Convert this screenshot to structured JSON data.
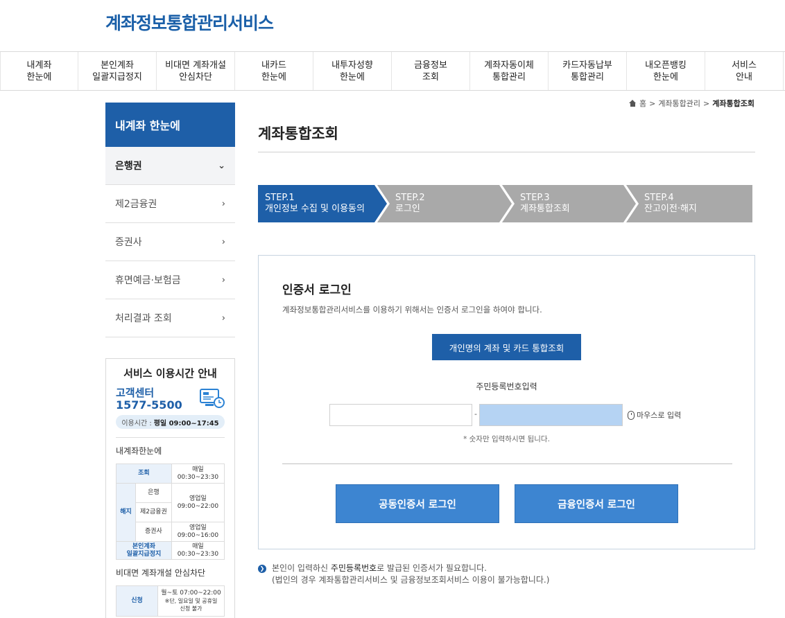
{
  "logo": "계좌정보통합관리서비스",
  "gnb": [
    "내계좌\n한눈에",
    "본인계좌\n일괄지급정지",
    "비대면 계좌개설\n안심차단",
    "내카드\n한눈에",
    "내투자성향\n한눈에",
    "금융정보\n조회",
    "계좌자동이체\n통합관리",
    "카드자동납부\n통합관리",
    "내오픈뱅킹\n한눈에",
    "서비스\n안내"
  ],
  "breadcrumb": {
    "home": "홈",
    "level1": "계좌통합관리",
    "current": "계좌통합조회"
  },
  "lnb": {
    "title": "내계좌 한눈에",
    "items": [
      "은행권",
      "제2금융권",
      "증권사",
      "휴면예금·보험금",
      "처리결과 조회"
    ]
  },
  "service_info": {
    "title": "서비스 이용시간 안내",
    "center_label": "고객센터",
    "phone": "1577-5500",
    "hours_label": "이용시간 :",
    "hours_value": "평일 09:00~17:45",
    "section1": "내계좌한눈에",
    "t_inquiry": "조회",
    "t_inquiry_time": "매일\n00:30~23:30",
    "t_cancel": "해지",
    "t_bank": "은행",
    "t_bank_time": "영업일\n09:00~22:00",
    "t_second": "제2금융권",
    "t_securities": "증권사",
    "t_securities_time": "영업일\n09:00~16:00",
    "t_freeze": "본인계좌\n일괄지급정지",
    "t_freeze_time": "매일\n00:30~23:30",
    "section2": "비대면 계좌개설 안심차단",
    "t_apply": "신청",
    "t_apply_time": "월~토 07:00~22:00",
    "t_apply_note": "※단, 일요일 및 공휴일\n신청 불가"
  },
  "main": {
    "title": "계좌통합조회",
    "steps": [
      {
        "label": "STEP.1\n개인정보 수집 및 이용동의",
        "active": true
      },
      {
        "label": "STEP.2\n로그인",
        "active": false
      },
      {
        "label": "STEP.3\n계좌통합조회",
        "active": false
      },
      {
        "label": "STEP.4\n잔고이전·해지",
        "active": false
      }
    ]
  },
  "login": {
    "title": "인증서 로그인",
    "desc": "계좌정보통합관리서비스를 이용하기 위해서는 인증서 로그인을 하여야 합니다.",
    "personal_button": "개인명의 계좌 및 카드 통합조회",
    "rrn_label": "주민등록번호입력",
    "dash": "-",
    "mouse_input": "마우스로 입력",
    "note": "* 숫자만 입력하시면 됩니다.",
    "joint_cert_button": "공동인증서 로그인",
    "fin_cert_button": "금융인증서 로그인"
  },
  "notice": {
    "pre": "본인이 입력하신 ",
    "em": "주민등록번호",
    "post": "로 발급된 인증서가 필요합니다.",
    "line2": "(법인의 경우 계좌통합관리서비스 및 금융정보조회서비스 이용이 불가능합니다.)"
  },
  "colors": {
    "primary": "#1e5fa8",
    "step_inactive": "#a9a9a9",
    "button_login": "#3d85d1",
    "rrn_active": "#b5d3f3"
  }
}
